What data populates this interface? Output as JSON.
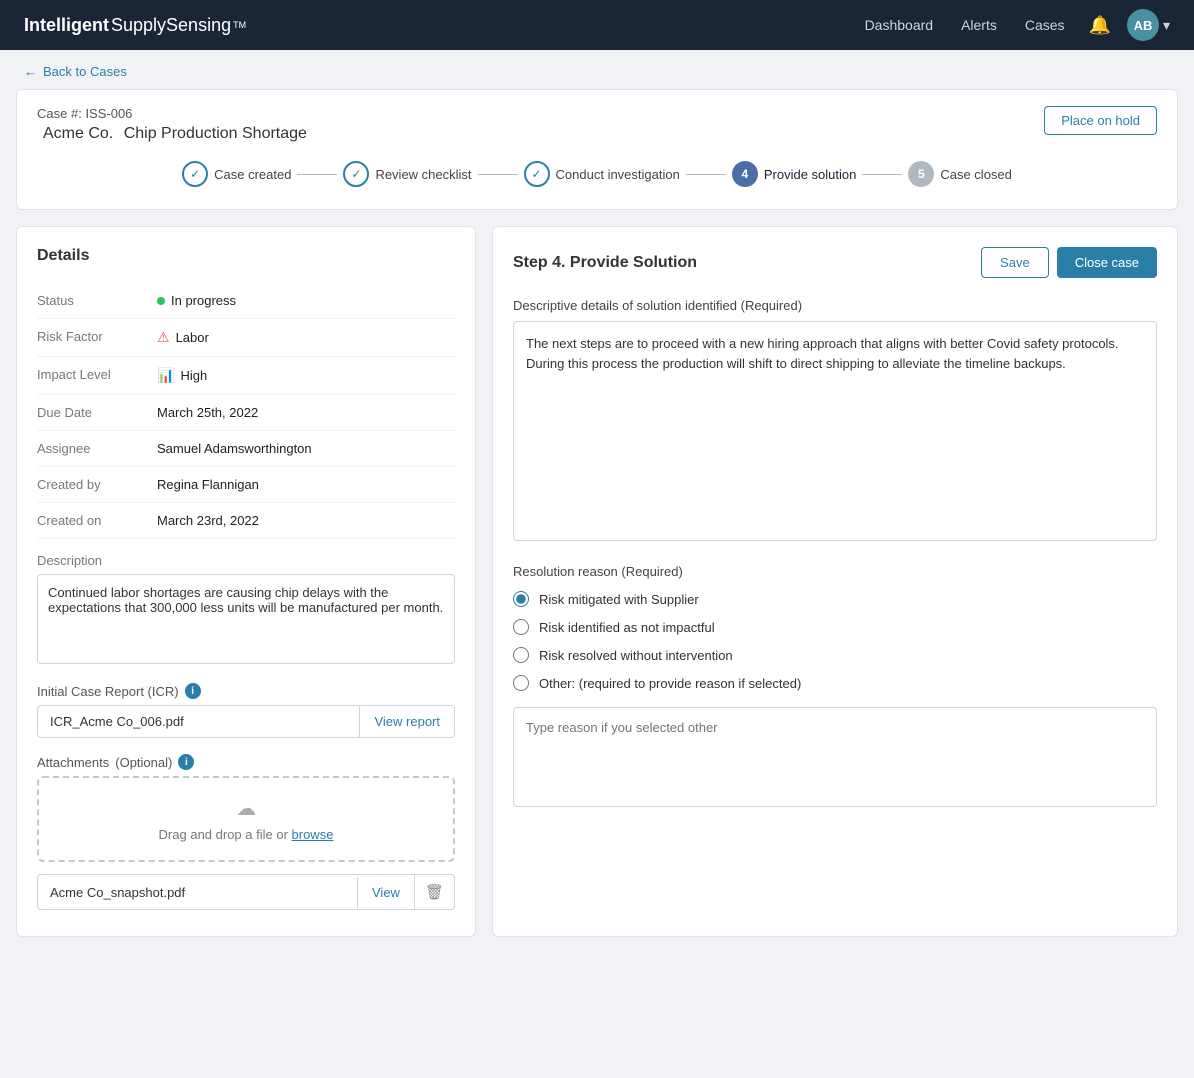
{
  "nav": {
    "brand": "IntelligentSupplySensing",
    "brand_tm": "TM",
    "links": [
      "Dashboard",
      "Alerts",
      "Cases"
    ],
    "avatar_initials": "AB"
  },
  "back": {
    "label": "Back to Cases"
  },
  "case_header": {
    "case_num_label": "Case #:",
    "case_num": "ISS-006",
    "company": "Acme Co.",
    "title": "Chip Production Shortage",
    "hold_button": "Place on hold"
  },
  "steps": [
    {
      "id": "case-created",
      "label": "Case created",
      "type": "done",
      "symbol": "✓"
    },
    {
      "id": "review-checklist",
      "label": "Review checklist",
      "type": "done",
      "symbol": "✓"
    },
    {
      "id": "conduct-investigation",
      "label": "Conduct investigation",
      "type": "done",
      "symbol": "✓"
    },
    {
      "id": "provide-solution",
      "label": "Provide solution",
      "type": "active",
      "symbol": "4"
    },
    {
      "id": "case-closed",
      "label": "Case closed",
      "type": "inactive",
      "symbol": "5"
    }
  ],
  "details": {
    "panel_title": "Details",
    "rows": [
      {
        "label": "Status",
        "value": "In progress",
        "type": "status"
      },
      {
        "label": "Risk Factor",
        "value": "Labor",
        "type": "risk"
      },
      {
        "label": "Impact Level",
        "value": "High",
        "type": "impact"
      },
      {
        "label": "Due Date",
        "value": "March 25th, 2022",
        "type": "text"
      },
      {
        "label": "Assignee",
        "value": "Samuel Adamsworthington",
        "type": "text"
      },
      {
        "label": "Created by",
        "value": "Regina Flannigan",
        "type": "text"
      },
      {
        "label": "Created on",
        "value": "March 23rd, 2022",
        "type": "text"
      }
    ],
    "description_label": "Description",
    "description_value": "Continued labor shortages are causing chip delays with the expectations that 300,000 less units will be manufactured per month.",
    "icr_label": "Initial Case Report (ICR)",
    "icr_filename": "ICR_Acme Co_006.pdf",
    "icr_view_btn": "View report",
    "attachments_label": "Attachments",
    "attachments_optional": "(Optional)",
    "drop_text": "Drag and drop a file or ",
    "browse_text": "browse",
    "attachments": [
      {
        "name": "Acme Co_snapshot.pdf",
        "view_label": "View"
      }
    ]
  },
  "step4": {
    "title": "Step 4. Provide Solution",
    "save_btn": "Save",
    "close_case_btn": "Close case",
    "solution_label": "Descriptive details of solution identified (Required)",
    "solution_value": "The next steps are to proceed with a new hiring approach that aligns with better Covid safety protocols. During this process the production will shift to direct shipping to alleviate the timeline backups.",
    "resolution_label": "Resolution reason (Required)",
    "radio_options": [
      {
        "id": "opt1",
        "label": "Risk mitigated with Supplier",
        "checked": true
      },
      {
        "id": "opt2",
        "label": "Risk identified as not impactful",
        "checked": false
      },
      {
        "id": "opt3",
        "label": "Risk resolved without intervention",
        "checked": false
      },
      {
        "id": "opt4",
        "label": "Other: (required to provide reason if selected)",
        "checked": false
      }
    ],
    "other_placeholder": "Type reason if you selected other"
  }
}
